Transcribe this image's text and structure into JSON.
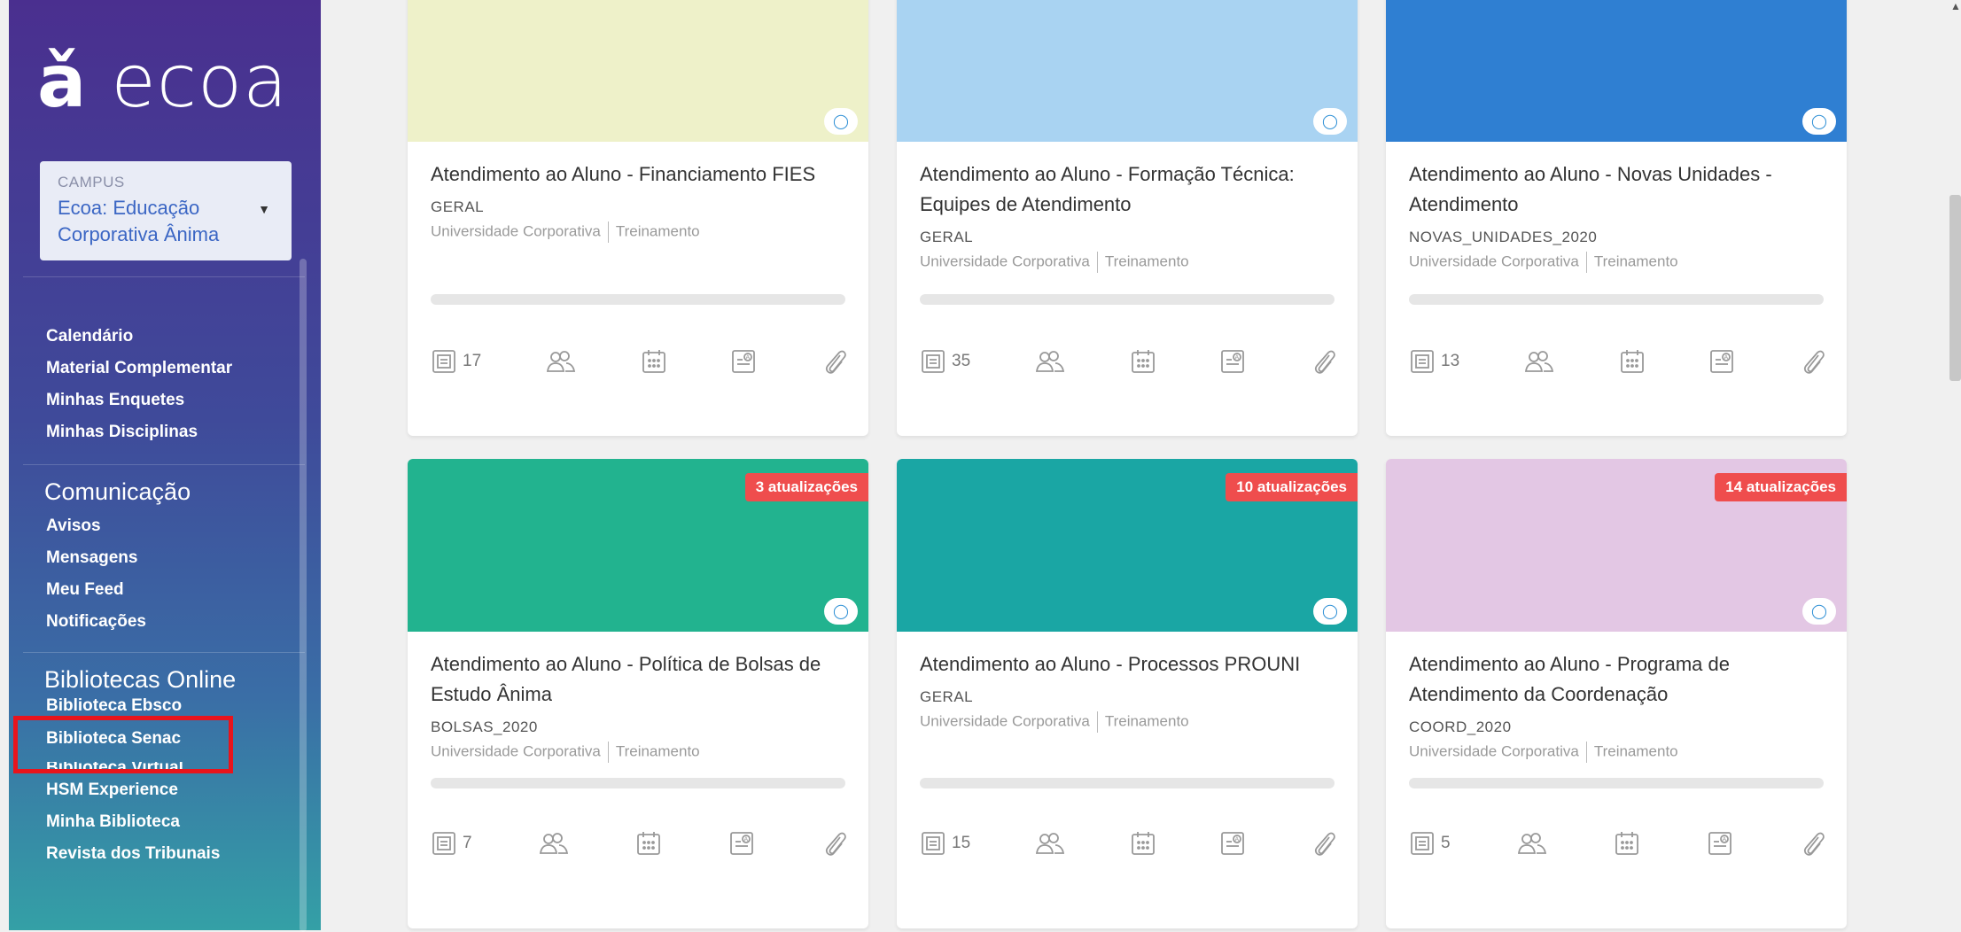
{
  "sidebar": {
    "logo": "ecoa",
    "logo_glyph": "ǎ",
    "campus_label": "CAMPUS",
    "campus_value": "Ecoa: Educação Corporativa Ânima",
    "nav_main": [
      "Calendário",
      "Material Complementar",
      "Minhas Enquetes",
      "Minhas Disciplinas"
    ],
    "comunicacao_title": "Comunicação",
    "comunicacao": [
      "Avisos",
      "Mensagens",
      "Meu Feed",
      "Notificações"
    ],
    "bibliotecas_title": "Bibliotecas Online",
    "bibliotecas": [
      "Biblioteca Ebsco",
      "Biblioteca Senac",
      "Biblioteca Virtual",
      "HSM Experience",
      "Minha Biblioteca",
      "Revista dos Tribunais"
    ]
  },
  "cards": [
    {
      "title": "Atendimento ao Aluno - Financiamento FIES",
      "code": "GERAL",
      "org": "Universidade Corporativa",
      "type": "Treinamento",
      "count": "17",
      "badge": "",
      "color": "#eef1c9"
    },
    {
      "title": "Atendimento ao Aluno - Formação Técnica: Equipes de Atendimento",
      "code": "GERAL",
      "org": "Universidade Corporativa",
      "type": "Treinamento",
      "count": "35",
      "badge": "",
      "color": "#a9d3f2"
    },
    {
      "title": "Atendimento ao Aluno - Novas Unidades - Atendimento",
      "code": "NOVAS_UNIDADES_2020",
      "org": "Universidade Corporativa",
      "type": "Treinamento",
      "count": "13",
      "badge": "",
      "color": "#2f7fd2"
    },
    {
      "title": "Atendimento ao Aluno - Política de Bolsas de Estudo Ânima",
      "code": "BOLSAS_2020",
      "org": "Universidade Corporativa",
      "type": "Treinamento",
      "count": "7",
      "badge": "3 atualizações",
      "color": "#22b38f"
    },
    {
      "title": "Atendimento ao Aluno - Processos PROUNI",
      "code": "GERAL",
      "org": "Universidade Corporativa",
      "type": "Treinamento",
      "count": "15",
      "badge": "10 atualizações",
      "color": "#1aa6a4"
    },
    {
      "title": "Atendimento ao Aluno - Programa de Atendimento da Coordenação",
      "code": "COORD_2020",
      "org": "Universidade Corporativa",
      "type": "Treinamento",
      "count": "5",
      "badge": "14 atualizações",
      "color": "#e3c7e4"
    }
  ],
  "icons": [
    "content-icon",
    "participants-icon",
    "calendar-icon",
    "activities-icon",
    "attachment-icon"
  ]
}
